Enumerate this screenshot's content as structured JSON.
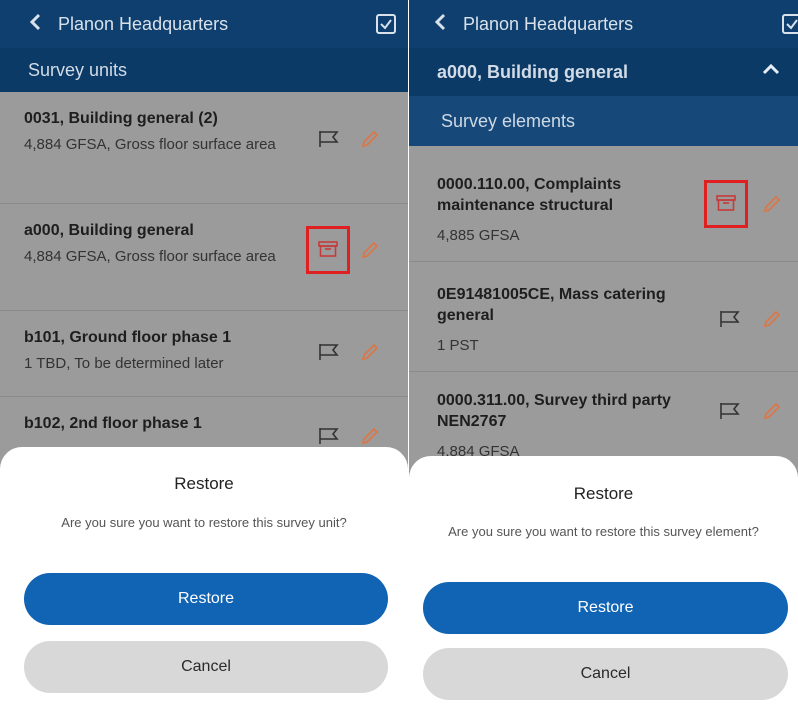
{
  "left": {
    "header": {
      "title": "Planon Headquarters"
    },
    "subheader": "Survey units",
    "items": [
      {
        "name": "0031, Building general (2)",
        "desc": "4,884 GFSA, Gross floor surface area"
      },
      {
        "name": "a000, Building general",
        "desc": "4,884 GFSA, Gross floor surface area"
      },
      {
        "name": "b101, Ground floor phase 1",
        "desc": "1 TBD, To be determined later"
      },
      {
        "name": "b102, 2nd floor phase 1",
        "desc": ""
      }
    ],
    "dialog": {
      "title": "Restore",
      "message": "Are you sure you want to restore this survey unit?",
      "restore_label": "Restore",
      "cancel_label": "Cancel"
    }
  },
  "right": {
    "header": {
      "title": "Planon Headquarters"
    },
    "section": "a000, Building general",
    "subheader": "Survey elements",
    "items": [
      {
        "name": "0000.110.00, Complaints maintenance structural",
        "desc": "4,885 GFSA"
      },
      {
        "name": "0E91481005CE, Mass catering general",
        "desc": "1 PST"
      },
      {
        "name": "0000.311.00, Survey third party NEN2767",
        "desc": "4,884 GFSA"
      }
    ],
    "dialog": {
      "title": "Restore",
      "message": "Are you sure you want to restore this survey element?",
      "restore_label": "Restore",
      "cancel_label": "Cancel"
    }
  },
  "colors": {
    "header_bg": "#0e3f6e",
    "primary_button": "#1164b4",
    "highlight_box": "#e02020",
    "pencil": "#d9784a"
  },
  "icons": [
    "back-chevron-icon",
    "checkbox-icon",
    "flag-icon",
    "pencil-icon",
    "archive-box-icon",
    "chevron-up-icon"
  ]
}
